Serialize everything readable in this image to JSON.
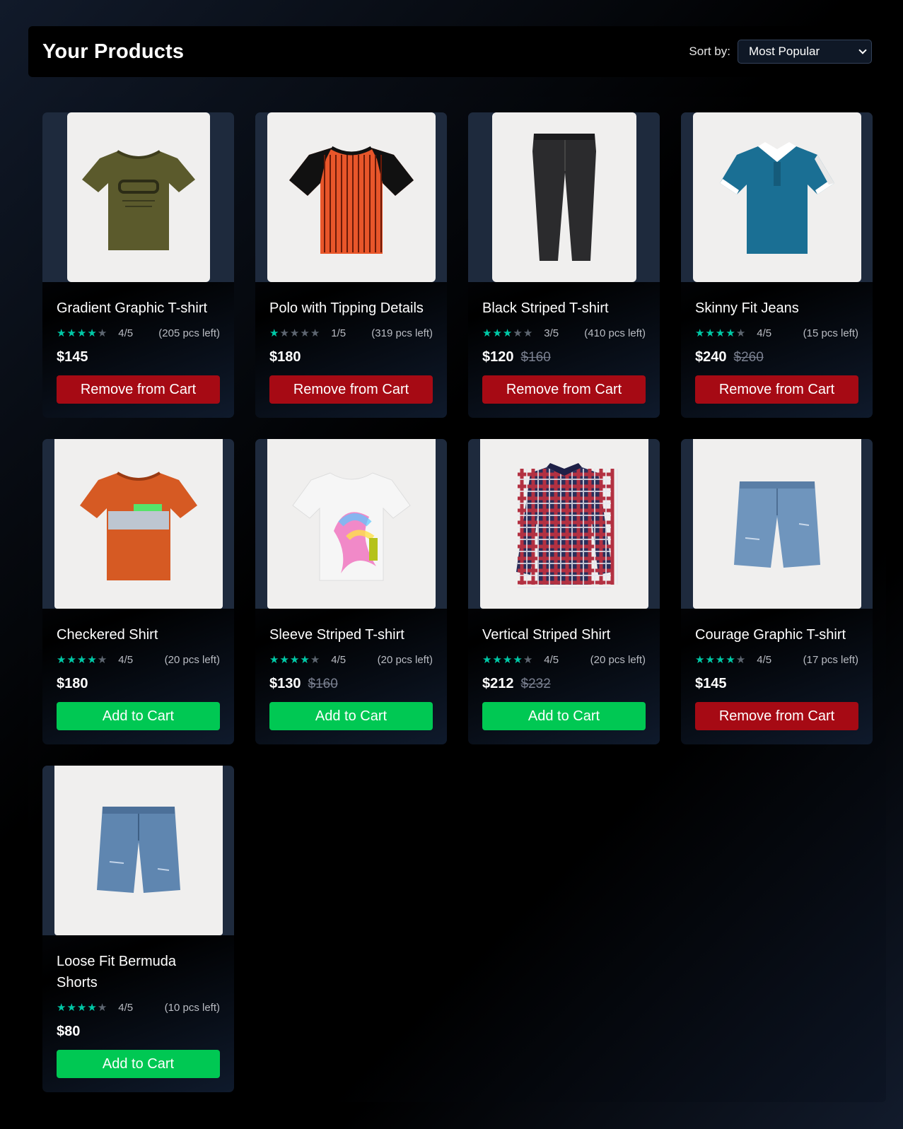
{
  "header": {
    "title": "Your Products",
    "sort_label": "Sort by:",
    "sort_value": "Most Popular"
  },
  "colors": {
    "add": "#00c853",
    "remove": "#a60a14",
    "star": "#00c9a7"
  },
  "products": [
    {
      "name": "Gradient Graphic T-shirt",
      "stars": 4,
      "rating": "4/5",
      "stock": "(205 pcs left)",
      "price": "$145",
      "old_price": "",
      "action": "Remove from Cart",
      "state": "remove",
      "icon": "olive-tshirt",
      "img_w": 202
    },
    {
      "name": "Polo with Tipping Details",
      "stars": 1,
      "rating": "1/5",
      "stock": "(319 pcs left)",
      "price": "$180",
      "old_price": "",
      "action": "Remove from Cart",
      "state": "remove",
      "icon": "orange-striped-raglan-tshirt",
      "img_w": 238
    },
    {
      "name": "Black Striped T-shirt",
      "stars": 3,
      "rating": "3/5",
      "stock": "(410 pcs left)",
      "price": "$120",
      "old_price": "$160",
      "action": "Remove from Cart",
      "state": "remove",
      "icon": "black-jeans",
      "img_w": 204
    },
    {
      "name": "Skinny Fit Jeans",
      "stars": 4,
      "rating": "4/5",
      "stock": "(15 pcs left)",
      "price": "$240",
      "old_price": "$260",
      "action": "Remove from Cart",
      "state": "remove",
      "icon": "teal-polo",
      "img_w": 238
    },
    {
      "name": "Checkered Shirt",
      "stars": 4,
      "rating": "4/5",
      "stock": "(20 pcs left)",
      "price": "$180",
      "old_price": "",
      "action": "Add to Cart",
      "state": "add",
      "icon": "orange-courage-tshirt",
      "img_w": 238
    },
    {
      "name": "Sleeve Striped T-shirt",
      "stars": 4,
      "rating": "4/5",
      "stock": "(20 pcs left)",
      "price": "$130",
      "old_price": "$160",
      "action": "Add to Cart",
      "state": "add",
      "icon": "white-gradient-tshirt",
      "img_w": 238
    },
    {
      "name": "Vertical Striped Shirt",
      "stars": 4,
      "rating": "4/5",
      "stock": "(20 pcs left)",
      "price": "$212",
      "old_price": "$232",
      "action": "Add to Cart",
      "state": "add",
      "icon": "plaid-shirt",
      "img_w": 238
    },
    {
      "name": "Courage Graphic T-shirt",
      "stars": 4,
      "rating": "4/5",
      "stock": "(17 pcs left)",
      "price": "$145",
      "old_price": "",
      "action": "Remove from Cart",
      "state": "remove",
      "icon": "denim-shorts",
      "img_w": 238
    },
    {
      "name": "Loose Fit Bermuda Shorts",
      "stars": 4,
      "rating": "4/5",
      "stock": "(10 pcs left)",
      "price": "$80",
      "old_price": "",
      "action": "Add to Cart",
      "state": "add",
      "icon": "denim-bermuda-shorts",
      "img_w": 238
    }
  ]
}
